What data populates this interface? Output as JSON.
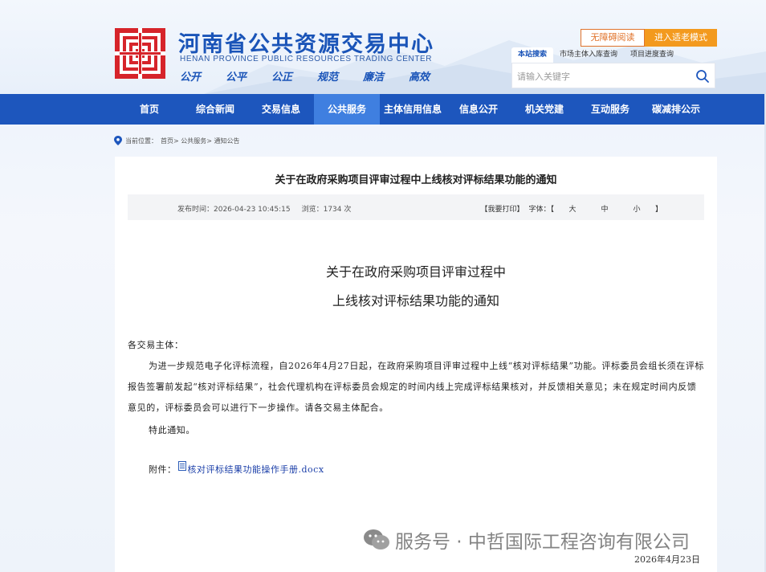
{
  "header": {
    "title": "河南省公共资源交易中心",
    "subtitle": "HENAN PROVINCE PUBLIC RESOURCES TRADING CENTER",
    "mottos": [
      "公开",
      "公平",
      "公正",
      "规范",
      "廉洁",
      "高效"
    ],
    "access_label": "无障碍阅读",
    "elder_label": "进入适老模式",
    "search_tabs": [
      "本站搜索",
      "市场主体入库查询",
      "项目进度查询"
    ],
    "search_placeholder": "请输入关键字",
    "colors": {
      "brand_blue": "#1d56bd",
      "logo_red": "#d6242a",
      "accent_orange": "#f39a1e"
    }
  },
  "nav": {
    "items": [
      "首页",
      "综合新闻",
      "交易信息",
      "公共服务",
      "主体信用信息",
      "信息公开",
      "机关党建",
      "互动服务",
      "碳减排公示"
    ],
    "active_index": 3
  },
  "breadcrumb": {
    "label": "当前位置：",
    "path": "首页> 公共服务> 通知公告"
  },
  "article": {
    "title": "关于在政府采购项目评审过程中上线核对评标结果功能的通知",
    "publish_time": "发布时间：2026-04-23 10:45:15",
    "views": "浏览：1734 次",
    "print_label": "【我要打印】",
    "font_label": "字体：【",
    "font_sizes": [
      "大",
      "中",
      "小"
    ],
    "font_close": "】",
    "doc_title_line1": "关于在政府采购项目评审过程中",
    "doc_title_line2": "上线核对评标结果功能的通知",
    "salutation": "各交易主体：",
    "paragraph": "为进一步规范电子化评标流程，自2026年4月27日起，在政府采购项目评审过程中上线“核对评标结果”功能。评标委员会组长须在评标报告签署前发起“核对评标结果”，社会代理机构在评标委员会规定的时间内线上完成评标结果核对，并反馈相关意见；未在规定时间内反馈意见的，评标委员会可以进行下一步操作。请各交易主体配合。",
    "closing": "特此通知。",
    "attachment_label": "附件：",
    "attachment_name": "核对评标结果功能操作手册.docx",
    "date": "2026年4月23日"
  },
  "watermark": {
    "text": "服务号 · 中哲国际工程咨询有限公司"
  }
}
